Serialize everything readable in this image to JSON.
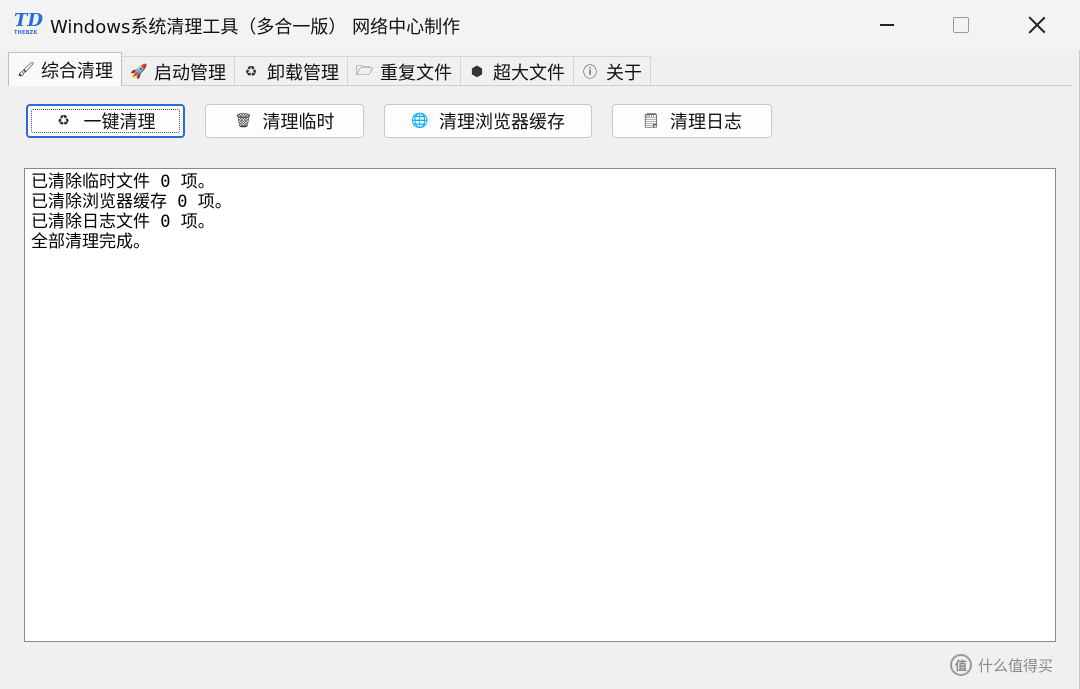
{
  "window": {
    "title": "Windows系统清理工具（多合一版） 网络中心制作",
    "logo_text": "TD",
    "logo_subtext": "THEBZK"
  },
  "tabs": [
    {
      "label": "综合清理",
      "icon": "brush-icon",
      "active": true
    },
    {
      "label": "启动管理",
      "icon": "rocket-icon",
      "active": false
    },
    {
      "label": "卸载管理",
      "icon": "recycle-icon",
      "active": false
    },
    {
      "label": "重复文件",
      "icon": "folder-icon",
      "active": false
    },
    {
      "label": "超大文件",
      "icon": "package-icon",
      "active": false
    },
    {
      "label": "关于",
      "icon": "info-icon",
      "active": false
    }
  ],
  "actions": {
    "one_click": "一键清理",
    "clean_temp": "清理临时",
    "clean_browser": "清理浏览器缓存",
    "clean_logs": "清理日志"
  },
  "log_lines": [
    "已清除临时文件 0 项。",
    "已清除浏览器缓存 0 项。",
    "已清除日志文件 0 项。",
    "全部清理完成。"
  ],
  "watermark": {
    "badge": "值",
    "text": "什么值得买"
  },
  "colors": {
    "accent": "#2e6bd1",
    "window_bg": "#f0f0f0",
    "log_bg": "#ffffff"
  }
}
